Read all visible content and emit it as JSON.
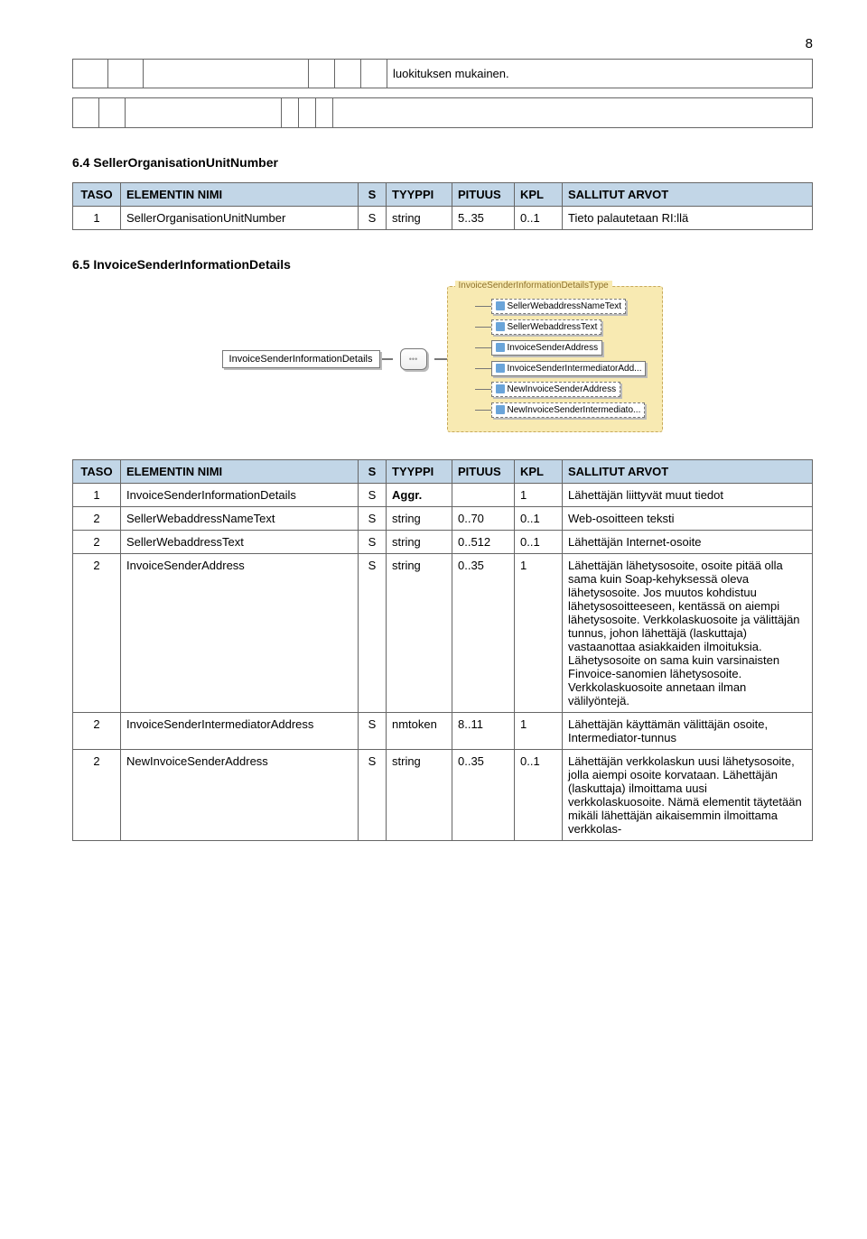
{
  "page_number": "8",
  "hanging_text": "luokituksen mukainen.",
  "section_64": {
    "heading": "6.4 SellerOrganisationUnitNumber",
    "headers": {
      "taso": "TASO",
      "nimi": "ELEMENTIN NIMI",
      "s": "S",
      "tyyppi": "TYYPPI",
      "pituus": "PITUUS",
      "kpl": "KPL",
      "arvot": "SALLITUT ARVOT"
    },
    "rows": [
      {
        "taso": "1",
        "nimi": "SellerOrganisationUnitNumber",
        "s": "S",
        "tyyppi": "string",
        "pituus": "5..35",
        "kpl": "0..1",
        "arvot": "Tieto palautetaan RI:llä"
      }
    ]
  },
  "section_65": {
    "heading": "6.5 InvoiceSenderInformationDetails",
    "diagram": {
      "root": "InvoiceSenderInformationDetails",
      "group_title": "InvoiceSenderInformationDetailsType",
      "items": [
        {
          "label": "SellerWebaddressNameText",
          "dashed": true
        },
        {
          "label": "SellerWebaddressText",
          "dashed": true
        },
        {
          "label": "InvoiceSenderAddress",
          "dashed": false
        },
        {
          "label": "InvoiceSenderIntermediatorAdd...",
          "dashed": false
        },
        {
          "label": "NewInvoiceSenderAddress",
          "dashed": true
        },
        {
          "label": "NewInvoiceSenderIntermediato...",
          "dashed": true
        }
      ]
    },
    "headers": {
      "taso": "TASO",
      "nimi": "ELEMENTIN NIMI",
      "s": "S",
      "tyyppi": "TYYPPI",
      "pituus": "PITUUS",
      "kpl": "KPL",
      "arvot": "SALLITUT ARVOT"
    },
    "rows": [
      {
        "taso": "1",
        "nimi": "InvoiceSenderInformationDetails",
        "s": "S",
        "tyyppi": "Aggr.",
        "pituus": "",
        "kpl": "1",
        "arvot": "Lähettäjän liittyvät muut tiedot",
        "bold_tyyppi": true
      },
      {
        "taso": "2",
        "nimi": "SellerWebaddressNameText",
        "s": "S",
        "tyyppi": "string",
        "pituus": "0..70",
        "kpl": "0..1",
        "arvot": "Web-osoitteen teksti"
      },
      {
        "taso": "2",
        "nimi": "SellerWebaddressText",
        "s": "S",
        "tyyppi": "string",
        "pituus": "0..512",
        "kpl": "0..1",
        "arvot": "Lähettäjän Internet-osoite"
      },
      {
        "taso": "2",
        "nimi": "InvoiceSenderAddress",
        "s": "S",
        "tyyppi": "string",
        "pituus": "0..35",
        "kpl": "1",
        "arvot": "Lähettäjän lähetysosoite, osoite pitää olla sama kuin Soap-kehyksessä oleva lähetysosoite. Jos muutos kohdistuu lähetysosoitteeseen, kentässä on aiempi lähetysosoite. Verkkolaskuosoite ja välittäjän tunnus, johon lähettäjä (laskuttaja) vastaanottaa asiakkaiden ilmoituksia. Lähetysosoite on sama kuin varsinaisten Finvoice-sanomien lähetysosoite. Verkkolaskuosoite annetaan ilman välilyöntejä."
      },
      {
        "taso": "2",
        "nimi": "InvoiceSenderIntermediatorAddress",
        "s": "S",
        "tyyppi": "nmtoken",
        "pituus": "8..11",
        "kpl": "1",
        "arvot": "Lähettäjän käyttämän välittäjän osoite, Intermediator-tunnus"
      },
      {
        "taso": "2",
        "nimi": "NewInvoiceSenderAddress",
        "s": "S",
        "tyyppi": "string",
        "pituus": "0..35",
        "kpl": "0..1",
        "arvot": "Lähettäjän verkkolaskun uusi lähetysosoite, jolla aiempi osoite korvataan. Lähettäjän (laskuttaja) ilmoittama uusi verkkolaskuosoite. Nämä elementit täytetään mikäli lähettäjän aikaisemmin ilmoittama verkkolas-"
      }
    ]
  }
}
